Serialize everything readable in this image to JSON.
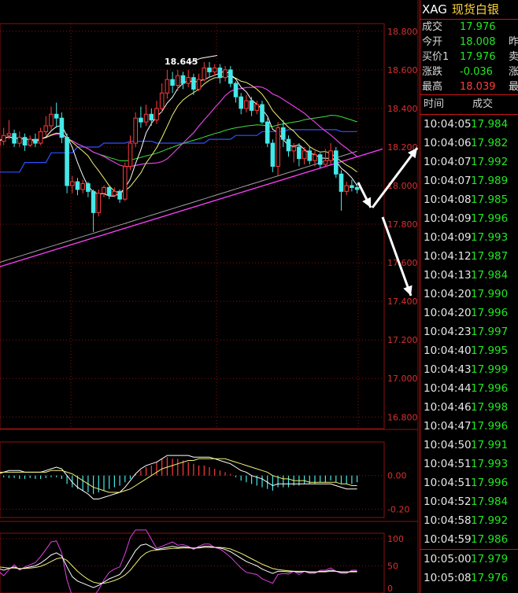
{
  "quote": {
    "symbol": "XAG",
    "name": "现货白银",
    "rows": [
      {
        "label": "成交",
        "value": "17.976",
        "color": "green",
        "label2": ""
      },
      {
        "label": "今开",
        "value": "18.008",
        "color": "green",
        "label2": "昨"
      },
      {
        "label": "买价1",
        "value": "17.976",
        "color": "green",
        "label2": "卖"
      },
      {
        "label": "涨跌",
        "value": "-0.036",
        "color": "green",
        "label2": "涨"
      },
      {
        "label": "最高",
        "value": "18.039",
        "color": "red",
        "label2": "最"
      }
    ],
    "ticks_header": {
      "time": "时间",
      "price": "成交"
    },
    "ticks": [
      {
        "time": "10:04:05",
        "price": "17.984"
      },
      {
        "time": "10:04:06",
        "price": "17.982"
      },
      {
        "time": "10:04:07",
        "price": "17.992"
      },
      {
        "time": "10:04:07",
        "price": "17.989"
      },
      {
        "time": "10:04:08",
        "price": "17.985"
      },
      {
        "time": "10:04:09",
        "price": "17.996"
      },
      {
        "time": "10:04:09",
        "price": "17.993"
      },
      {
        "time": "10:04:12",
        "price": "17.987"
      },
      {
        "time": "10:04:13",
        "price": "17.984"
      },
      {
        "time": "10:04:20",
        "price": "17.990"
      },
      {
        "time": "10:04:20",
        "price": "17.996"
      },
      {
        "time": "10:04:23",
        "price": "17.997"
      },
      {
        "time": "10:04:40",
        "price": "17.995"
      },
      {
        "time": "10:04:43",
        "price": "17.999"
      },
      {
        "time": "10:04:44",
        "price": "17.996"
      },
      {
        "time": "10:04:46",
        "price": "17.998"
      },
      {
        "time": "10:04:47",
        "price": "17.996"
      },
      {
        "time": "10:04:50",
        "price": "17.991"
      },
      {
        "time": "10:04:51",
        "price": "17.993"
      },
      {
        "time": "10:04:51",
        "price": "17.996"
      },
      {
        "time": "10:04:52",
        "price": "17.984"
      },
      {
        "time": "10:04:58",
        "price": "17.992"
      },
      {
        "time": "10:04:59",
        "price": "17.986"
      },
      {
        "time": "10:05:00",
        "price": "17.979"
      },
      {
        "time": "10:05:08",
        "price": "17.976"
      }
    ]
  },
  "chart_data": [
    {
      "type": "candlestick",
      "price_axis_labels": [
        "18.800",
        "18.600",
        "18.400",
        "18.200",
        "18.000",
        "17.800",
        "17.600",
        "17.400",
        "17.200",
        "17.000",
        "16.800"
      ],
      "ylim": [
        16.74,
        18.84
      ],
      "high_annotation": "18.645",
      "colors": {
        "up": "#ff3c3c",
        "down": "#44e8e8",
        "ma5": "#ffffff",
        "ma10": "#f0f078",
        "ma20": "#e040e0",
        "ma40": "#40e040",
        "ma60": "#3050ff",
        "ma120": "#a0a0a0",
        "trendline": "#ff40ff",
        "grid": "#8a1010"
      },
      "candles": [
        [
          18.21,
          18.23,
          18.3,
          18.2
        ],
        [
          18.23,
          18.26,
          18.3,
          18.21
        ],
        [
          18.26,
          18.27,
          18.34,
          18.24
        ],
        [
          18.27,
          18.22,
          18.29,
          18.2
        ],
        [
          18.22,
          18.25,
          18.28,
          18.2
        ],
        [
          18.25,
          18.21,
          18.27,
          18.18
        ],
        [
          18.21,
          18.24,
          18.26,
          18.2
        ],
        [
          18.24,
          18.22,
          18.27,
          18.2
        ],
        [
          18.22,
          18.28,
          18.3,
          18.21
        ],
        [
          18.28,
          18.31,
          18.36,
          18.26
        ],
        [
          18.31,
          18.37,
          18.41,
          18.29
        ],
        [
          18.37,
          18.35,
          18.43,
          18.3
        ],
        [
          18.35,
          18.25,
          18.38,
          18.22
        ],
        [
          18.25,
          18.0,
          18.27,
          17.96
        ],
        [
          18.0,
          18.02,
          18.05,
          17.96
        ],
        [
          18.02,
          17.98,
          18.04,
          17.95
        ],
        [
          17.98,
          18.01,
          18.03,
          17.96
        ],
        [
          18.01,
          17.97,
          18.02,
          17.94
        ],
        [
          17.97,
          17.86,
          17.98,
          17.76
        ],
        [
          17.86,
          17.96,
          17.98,
          17.84
        ],
        [
          17.96,
          17.99,
          18.0,
          17.94
        ],
        [
          17.99,
          17.95,
          18.0,
          17.93
        ],
        [
          17.95,
          17.97,
          17.99,
          17.94
        ],
        [
          17.97,
          17.93,
          17.98,
          17.91
        ],
        [
          17.93,
          18.1,
          18.12,
          17.92
        ],
        [
          18.1,
          18.22,
          18.26,
          18.08
        ],
        [
          18.22,
          18.35,
          18.38,
          18.2
        ],
        [
          18.35,
          18.33,
          18.41,
          18.3
        ],
        [
          18.33,
          18.37,
          18.42,
          18.31
        ],
        [
          18.37,
          18.34,
          18.4,
          18.31
        ],
        [
          18.34,
          18.4,
          18.44,
          18.32
        ],
        [
          18.4,
          18.48,
          18.53,
          18.38
        ],
        [
          18.48,
          18.55,
          18.6,
          18.45
        ],
        [
          18.55,
          18.52,
          18.59,
          18.48
        ],
        [
          18.52,
          18.57,
          18.6,
          18.49
        ],
        [
          18.57,
          18.53,
          18.59,
          18.5
        ],
        [
          18.53,
          18.56,
          18.6,
          18.51
        ],
        [
          18.56,
          18.5,
          18.58,
          18.47
        ],
        [
          18.5,
          18.55,
          18.58,
          18.49
        ],
        [
          18.55,
          18.61,
          18.64,
          18.54
        ],
        [
          18.61,
          18.59,
          18.64,
          18.56
        ],
        [
          18.59,
          18.61,
          18.63,
          18.57
        ],
        [
          18.61,
          18.56,
          18.63,
          18.53
        ],
        [
          18.56,
          18.6,
          18.62,
          18.54
        ],
        [
          18.6,
          18.53,
          18.62,
          18.51
        ],
        [
          18.53,
          18.46,
          18.54,
          18.43
        ],
        [
          18.46,
          18.4,
          18.48,
          18.37
        ],
        [
          18.4,
          18.44,
          18.47,
          18.38
        ],
        [
          18.44,
          18.39,
          18.46,
          18.36
        ],
        [
          18.39,
          18.42,
          18.44,
          18.37
        ],
        [
          18.42,
          18.33,
          18.44,
          18.32
        ],
        [
          18.33,
          18.22,
          18.35,
          18.2
        ],
        [
          18.22,
          18.1,
          18.24,
          18.07
        ],
        [
          18.1,
          18.3,
          18.33,
          18.05
        ],
        [
          18.3,
          18.24,
          18.34,
          18.2
        ],
        [
          18.24,
          18.18,
          18.26,
          18.15
        ],
        [
          18.18,
          18.2,
          18.22,
          18.12
        ],
        [
          18.2,
          18.14,
          18.22,
          18.1
        ],
        [
          18.14,
          18.18,
          18.2,
          18.11
        ],
        [
          18.18,
          18.13,
          18.2,
          18.11
        ],
        [
          18.13,
          18.16,
          18.18,
          18.1
        ],
        [
          18.16,
          18.11,
          18.17,
          18.09
        ],
        [
          18.11,
          18.13,
          18.19,
          18.1
        ],
        [
          18.13,
          18.18,
          18.22,
          18.11
        ],
        [
          18.18,
          18.06,
          18.2,
          18.04
        ],
        [
          18.06,
          17.97,
          18.08,
          17.87
        ],
        [
          17.97,
          18.0,
          18.02,
          17.95
        ],
        [
          18.0,
          17.99,
          18.03,
          17.97
        ],
        [
          17.99,
          17.98,
          18.01,
          17.96
        ]
      ]
    },
    {
      "type": "macd",
      "axis_labels": [
        "0.00",
        "-0.20"
      ],
      "ylim": [
        -0.25,
        0.2
      ],
      "histogram": [
        -0.01,
        -0.01,
        -0.015,
        -0.015,
        -0.02,
        -0.02,
        -0.015,
        -0.02,
        -0.02,
        -0.015,
        -0.01,
        -0.01,
        -0.02,
        -0.05,
        -0.07,
        -0.08,
        -0.09,
        -0.1,
        -0.11,
        -0.1,
        -0.09,
        -0.08,
        -0.07,
        -0.06,
        -0.04,
        -0.02,
        0.01,
        0.03,
        0.05,
        0.06,
        0.08,
        0.1,
        0.11,
        0.1,
        0.1,
        0.09,
        0.08,
        0.07,
        0.06,
        0.06,
        0.05,
        0.04,
        0.03,
        0.02,
        0.01,
        -0.01,
        -0.03,
        -0.04,
        -0.05,
        -0.06,
        -0.07,
        -0.08,
        -0.09,
        -0.07,
        -0.07,
        -0.07,
        -0.06,
        -0.06,
        -0.05,
        -0.05,
        -0.05,
        -0.04,
        -0.04,
        -0.03,
        -0.04,
        -0.05,
        -0.05,
        -0.05,
        -0.04
      ],
      "dif": [
        0.01,
        0.02,
        0.03,
        0.03,
        0.03,
        0.02,
        0.02,
        0.02,
        0.02,
        0.03,
        0.04,
        0.05,
        0.04,
        0.0,
        -0.04,
        -0.07,
        -0.09,
        -0.11,
        -0.14,
        -0.14,
        -0.13,
        -0.12,
        -0.11,
        -0.1,
        -0.07,
        -0.03,
        0.01,
        0.04,
        0.06,
        0.07,
        0.08,
        0.1,
        0.12,
        0.12,
        0.12,
        0.12,
        0.12,
        0.11,
        0.11,
        0.11,
        0.11,
        0.1,
        0.09,
        0.08,
        0.07,
        0.05,
        0.03,
        0.02,
        0.0,
        -0.01,
        -0.02,
        -0.04,
        -0.06,
        -0.05,
        -0.05,
        -0.05,
        -0.05,
        -0.05,
        -0.05,
        -0.05,
        -0.05,
        -0.05,
        -0.05,
        -0.05,
        -0.06,
        -0.07,
        -0.08,
        -0.08,
        -0.08
      ],
      "dea": [
        0.02,
        0.02,
        0.02,
        0.02,
        0.02,
        0.02,
        0.02,
        0.02,
        0.02,
        0.02,
        0.03,
        0.03,
        0.03,
        0.02,
        0.01,
        -0.01,
        -0.03,
        -0.05,
        -0.07,
        -0.08,
        -0.09,
        -0.1,
        -0.1,
        -0.1,
        -0.09,
        -0.08,
        -0.06,
        -0.04,
        -0.02,
        0.0,
        0.02,
        0.04,
        0.05,
        0.06,
        0.07,
        0.08,
        0.09,
        0.09,
        0.1,
        0.1,
        0.1,
        0.1,
        0.1,
        0.1,
        0.09,
        0.08,
        0.07,
        0.06,
        0.05,
        0.04,
        0.03,
        0.02,
        0.0,
        -0.01,
        -0.02,
        -0.02,
        -0.03,
        -0.03,
        -0.03,
        -0.04,
        -0.04,
        -0.04,
        -0.04,
        -0.04,
        -0.04,
        -0.05,
        -0.05,
        -0.06,
        -0.06
      ]
    },
    {
      "type": "kdj",
      "axis_labels": [
        "100",
        "50",
        "0"
      ],
      "ylim": [
        0,
        110
      ],
      "k": [
        45,
        42,
        45,
        48,
        44,
        46,
        48,
        50,
        55,
        62,
        70,
        74,
        68,
        48,
        30,
        22,
        18,
        14,
        10,
        14,
        20,
        26,
        30,
        34,
        46,
        62,
        78,
        88,
        90,
        85,
        80,
        82,
        84,
        86,
        84,
        85,
        84,
        82,
        84,
        86,
        86,
        84,
        83,
        80,
        76,
        70,
        64,
        58,
        54,
        50,
        44,
        40,
        36,
        40,
        40,
        39,
        40,
        38,
        40,
        38,
        38,
        40,
        40,
        42,
        40,
        38,
        38,
        40,
        40
      ],
      "d": [
        48,
        47,
        46,
        46,
        45,
        45,
        46,
        47,
        49,
        53,
        58,
        63,
        65,
        60,
        50,
        40,
        32,
        25,
        20,
        18,
        18,
        20,
        23,
        27,
        33,
        42,
        54,
        66,
        74,
        78,
        79,
        80,
        81,
        82,
        82,
        83,
        83,
        83,
        83,
        84,
        84,
        84,
        84,
        83,
        81,
        77,
        73,
        68,
        63,
        58,
        53,
        49,
        45,
        43,
        42,
        41,
        40,
        40,
        40,
        39,
        39,
        39,
        39,
        40,
        40,
        39,
        39,
        39,
        39
      ],
      "j": [
        40,
        32,
        43,
        52,
        42,
        48,
        52,
        56,
        67,
        80,
        94,
        96,
        74,
        24,
        -10,
        -14,
        -10,
        -8,
        -10,
        6,
        24,
        38,
        44,
        48,
        72,
        102,
        126,
        132,
        122,
        99,
        82,
        86,
        90,
        94,
        88,
        89,
        86,
        80,
        86,
        90,
        90,
        84,
        81,
        74,
        66,
        56,
        46,
        38,
        36,
        34,
        26,
        22,
        18,
        34,
        36,
        35,
        40,
        34,
        40,
        36,
        36,
        42,
        42,
        46,
        40,
        36,
        36,
        42,
        42
      ]
    }
  ]
}
